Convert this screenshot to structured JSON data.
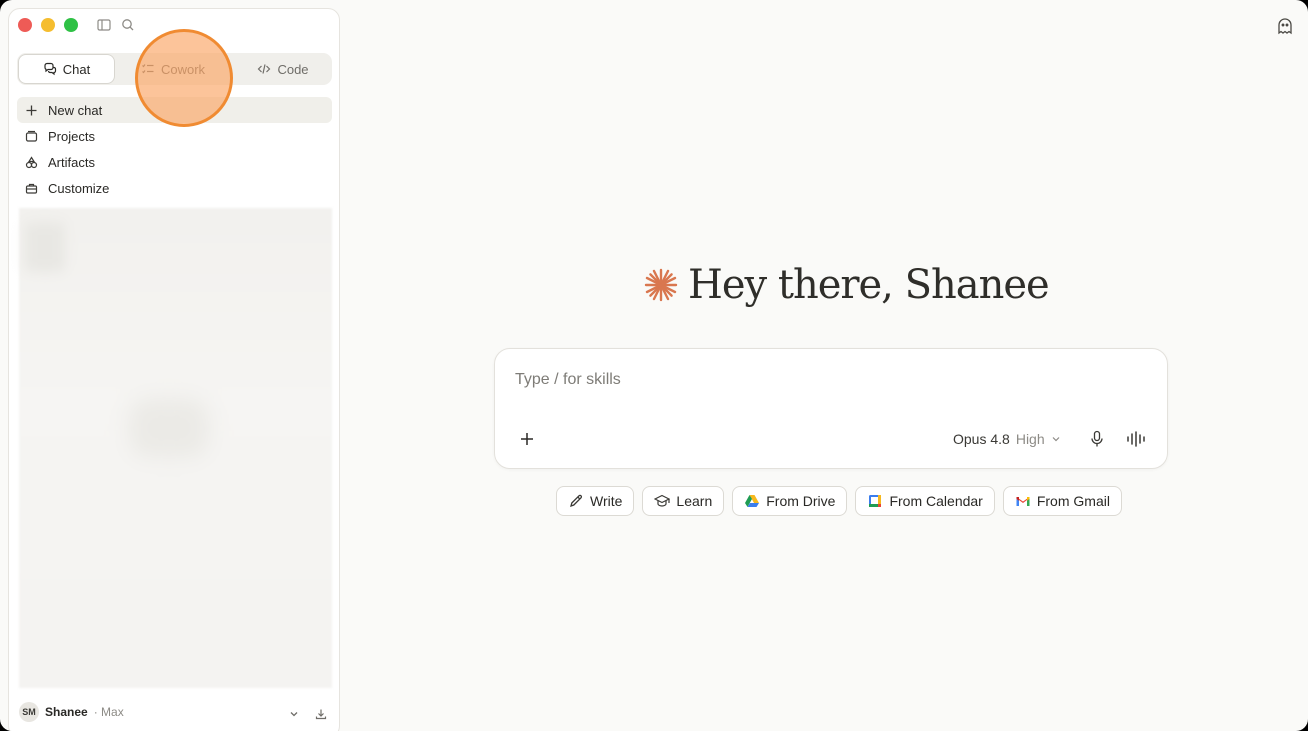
{
  "sidebar": {
    "tabs": [
      {
        "label": "Chat",
        "icon": "chat-bubbles-icon",
        "active": true
      },
      {
        "label": "Cowork",
        "icon": "checklist-icon",
        "active": false
      },
      {
        "label": "Code",
        "icon": "code-brackets-icon",
        "active": false
      }
    ],
    "nav": [
      {
        "label": "New chat",
        "icon": "plus-icon"
      },
      {
        "label": "Projects",
        "icon": "folder-icon"
      },
      {
        "label": "Artifacts",
        "icon": "shapes-icon"
      },
      {
        "label": "Customize",
        "icon": "briefcase-icon"
      }
    ],
    "user": {
      "initials": "SM",
      "name": "Shanee",
      "plan": "· Max"
    }
  },
  "main": {
    "greeting": "Hey there, Shanee",
    "composer": {
      "placeholder": "Type / for skills",
      "model": "Opus 4.8",
      "effort": "High"
    },
    "chips": [
      {
        "label": "Write",
        "icon": "pencil-icon"
      },
      {
        "label": "Learn",
        "icon": "graduation-cap-icon"
      },
      {
        "label": "From Drive",
        "icon": "google-drive-icon"
      },
      {
        "label": "From Calendar",
        "icon": "google-calendar-icon"
      },
      {
        "label": "From Gmail",
        "icon": "gmail-icon"
      }
    ]
  },
  "colors": {
    "accent": "#d9774f",
    "cursor_highlight": "#f08b32",
    "background": "#fafaf8"
  }
}
